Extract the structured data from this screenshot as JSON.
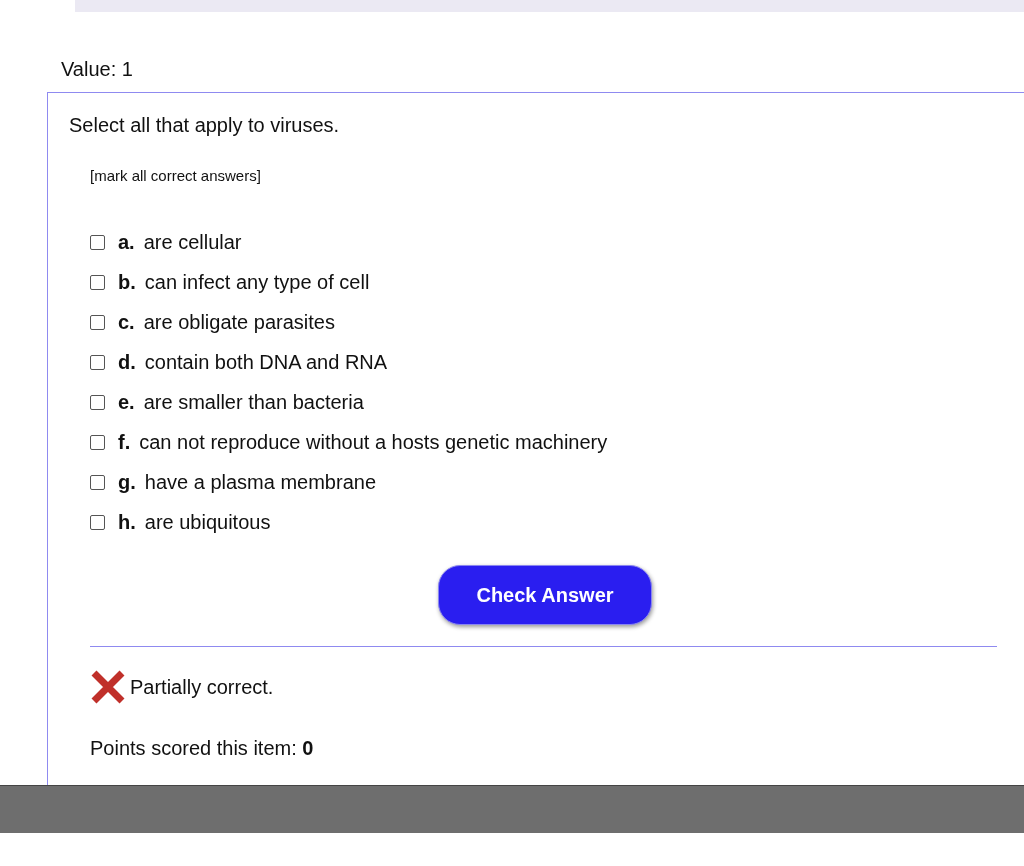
{
  "value_label": "Value: 1",
  "question": {
    "prompt": "Select all that apply to viruses.",
    "instruction": "[mark all correct answers]"
  },
  "options": [
    {
      "letter": "a.",
      "text": "are cellular",
      "checked": false
    },
    {
      "letter": "b.",
      "text": "can infect any type of cell",
      "checked": false
    },
    {
      "letter": "c.",
      "text": "are obligate parasites",
      "checked": false
    },
    {
      "letter": "d.",
      "text": "contain both DNA and RNA",
      "checked": false
    },
    {
      "letter": "e.",
      "text": "are smaller than bacteria",
      "checked": false
    },
    {
      "letter": "f.",
      "text": "can not reproduce without a hosts genetic machinery",
      "checked": false
    },
    {
      "letter": "g.",
      "text": "have a plasma membrane",
      "checked": false
    },
    {
      "letter": "h.",
      "text": "are ubiquitous",
      "checked": false
    }
  ],
  "check_button": "Check Answer",
  "feedback": {
    "correct": false,
    "text": "Partially correct."
  },
  "points": "Points scored this item: **0**"
}
